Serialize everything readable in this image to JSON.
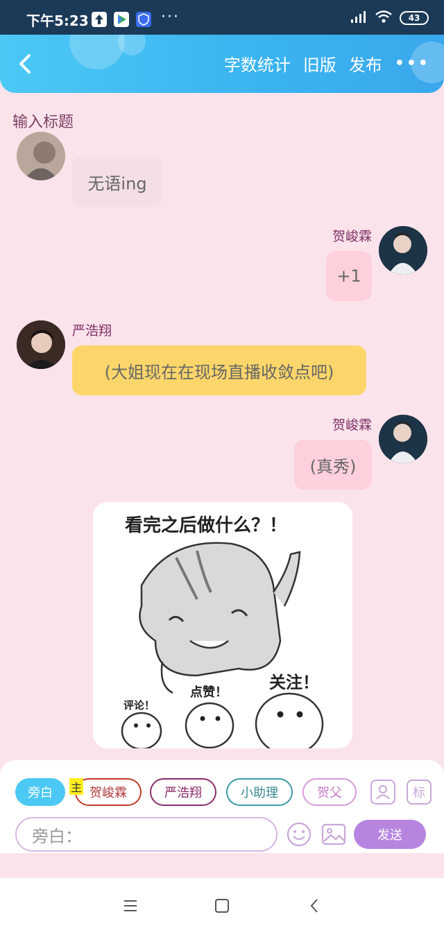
{
  "status": {
    "time": "下午5:23",
    "more": "···",
    "battery": "43"
  },
  "header": {
    "word_count": "字数统计",
    "old_version": "旧版",
    "publish": "发布",
    "more": "•••"
  },
  "title_placeholder": "输入标题",
  "messages": [
    {
      "side": "left",
      "name": "",
      "text": "无语ing",
      "bubble_color": "#f4dfe4"
    },
    {
      "side": "right",
      "name": "贺峻霖",
      "text": "+1",
      "bubble_color": "#fdd0dc"
    },
    {
      "side": "left",
      "name": "严浩翔",
      "text": "(大姐现在在现场直播收敛点吧)",
      "bubble_color": "#fcd66a"
    },
    {
      "side": "right",
      "name": "贺峻霖",
      "text": "(真秀)",
      "bubble_color": "#fdd0dc"
    }
  ],
  "sticker": {
    "title": "看完之后做什么？！",
    "label1": "评论！",
    "label2": "点赞！",
    "label3": "关注！"
  },
  "composer": {
    "chips": [
      "旁白",
      "贺峻霖",
      "严浩翔",
      "小助理",
      "贺父"
    ],
    "host_badge": "主",
    "tag_btn": "标",
    "input_placeholder": "旁白：",
    "send": "发送"
  },
  "colors": {
    "header": "#3ab3ef",
    "background": "#fbe3ec",
    "send": "#b784e0",
    "active_chip": "#4cc8f5"
  }
}
